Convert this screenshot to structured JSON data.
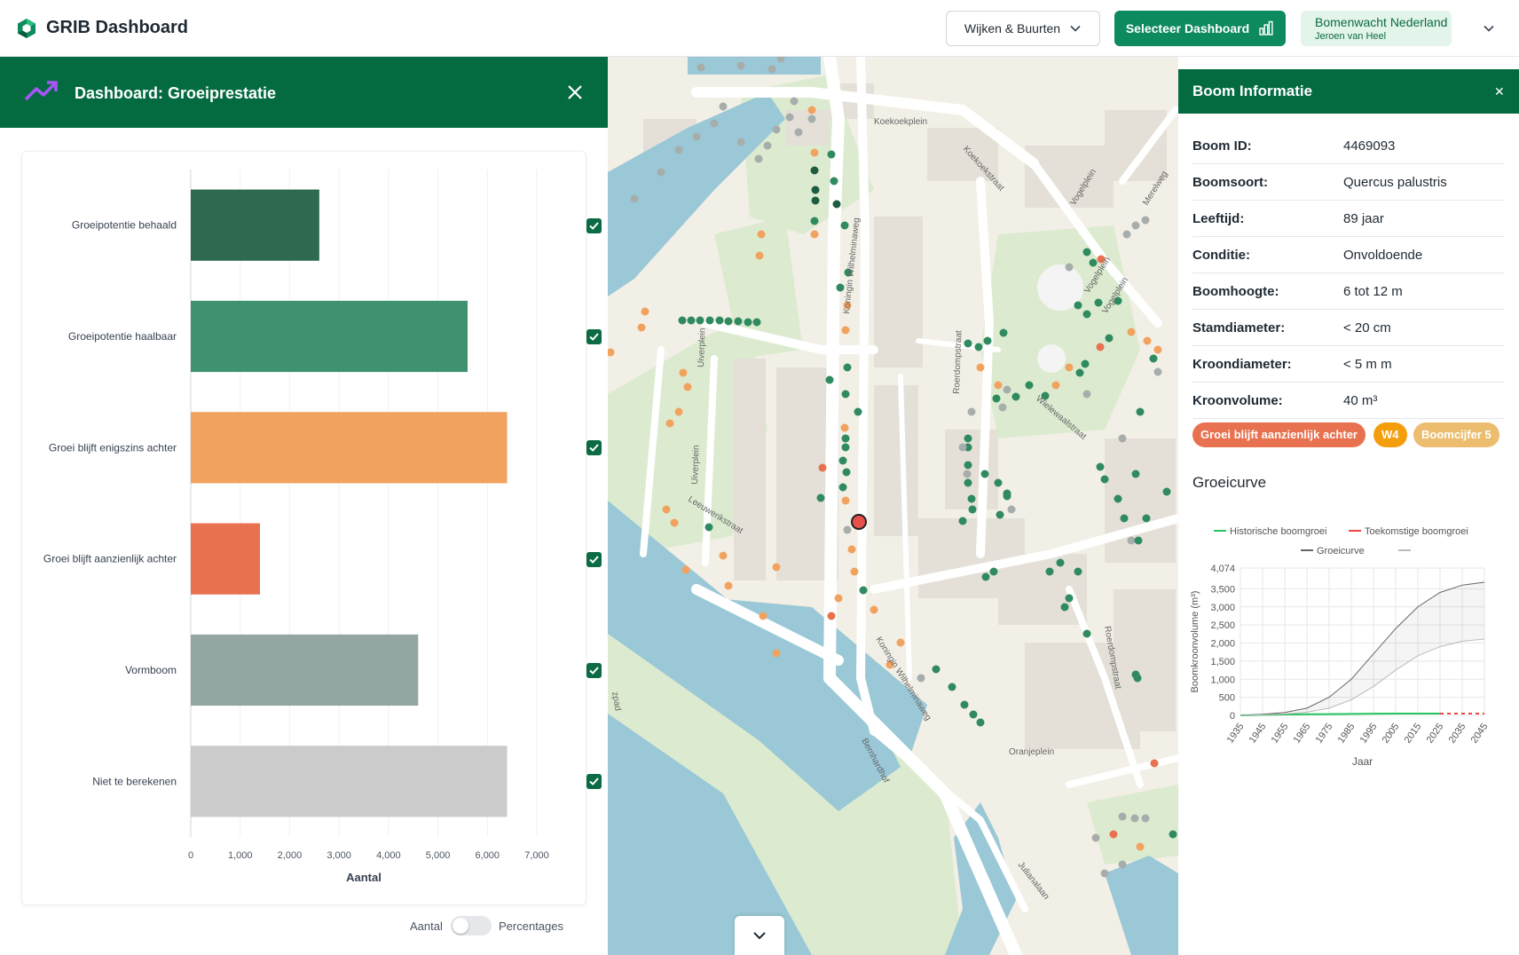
{
  "topbar": {
    "app_title": "GRIB Dashboard",
    "wijken_label": "Wijken & Buurten",
    "select_dashboard_label": "Selecteer Dashboard",
    "org_name": "Bomenwacht Nederland",
    "org_user": "Jeroen van Heel"
  },
  "dashboard": {
    "title": "Dashboard: Groeiprestatie",
    "toggle_left": "Aantal",
    "toggle_right": "Percentages",
    "toggle_state": "Aantal"
  },
  "chart_data": [
    {
      "type": "bar",
      "orientation": "horizontal",
      "categories": [
        "Groeipotentie behaald",
        "Groeipotentie haalbaar",
        "Groei blijft enigszins achter",
        "Groei blijft aanzienlijk achter",
        "Vormboom",
        "Niet te berekenen"
      ],
      "values": [
        2600,
        5600,
        6400,
        1400,
        4600,
        6400
      ],
      "colors": [
        "#2e6a4f",
        "#3f9270",
        "#f2a25f",
        "#e8714f",
        "#94a6a3",
        "#cbcbcb"
      ],
      "checked": [
        true,
        true,
        true,
        true,
        true,
        true
      ],
      "xlabel": "Aantal",
      "xlim": [
        0,
        7000
      ],
      "xticks": [
        "0",
        "1,000",
        "2,000",
        "3,000",
        "4,000",
        "5,000",
        "6,000",
        "7,000"
      ],
      "grid": true
    },
    {
      "type": "line",
      "title": "Groeicurve",
      "series": [
        {
          "name": "Historische boomgroei",
          "color": "#22c55e",
          "x": [
            1935,
            1945,
            1955,
            1965,
            1975,
            1985,
            1995,
            2005,
            2015,
            2025
          ],
          "y": [
            0,
            15,
            25,
            30,
            35,
            40,
            45,
            50,
            50,
            50
          ]
        },
        {
          "name": "Toekomstige boomgroei",
          "color": "#ef4444",
          "dashed": true,
          "x": [
            2025,
            2035,
            2045
          ],
          "y": [
            50,
            50,
            50
          ]
        },
        {
          "name": "Groeicurve",
          "color": "#666666",
          "x": [
            1935,
            1945,
            1955,
            1965,
            1975,
            1985,
            1995,
            2005,
            2015,
            2025,
            2035,
            2045
          ],
          "y": [
            0,
            30,
            80,
            200,
            500,
            1000,
            1700,
            2400,
            3000,
            3400,
            3600,
            3680
          ]
        },
        {
          "name": "",
          "color": "#bbbbbb",
          "x": [
            1935,
            1945,
            1955,
            1965,
            1975,
            1985,
            1995,
            2005,
            2015,
            2025,
            2035,
            2045
          ],
          "y": [
            0,
            15,
            40,
            90,
            200,
            430,
            800,
            1250,
            1650,
            1900,
            2050,
            2110
          ]
        }
      ],
      "xlabel": "Jaar",
      "ylabel": "Boomkroonvolume (m³)",
      "xlim": [
        1935,
        2045
      ],
      "ylim": [
        0,
        4074
      ],
      "yticks": [
        "4,074",
        "3,500",
        "3,000",
        "2,500",
        "2,000",
        "1,500",
        "1,000",
        "500",
        "0"
      ],
      "xticks": [
        "1935",
        "1945",
        "1955",
        "1965",
        "1975",
        "1985",
        "1995",
        "2005",
        "2015",
        "2025",
        "2035",
        "2045"
      ],
      "grid": true
    }
  ],
  "map": {
    "labels": [
      "Koekoekplein",
      "Koekoekstraat",
      "Vogelplein",
      "Vogelplein",
      "Vogelplein",
      "Koningin Wilhelminaweg",
      "Uiverplein",
      "Uiverplein",
      "Leeuwerikstraat",
      "Roerdompstraat",
      "Wielewaalstraat",
      "Koningin Wilhelminaweg",
      "Bernhardhof",
      "Oranjeplein",
      "Roerdompstraat",
      "Julianalaan",
      "Merelweg",
      "zpad"
    ],
    "colors": {
      "water": "#9ac8d6",
      "park": "#dcebd0",
      "road": "#ffffff",
      "building": "#e4e0d8"
    }
  },
  "boom": {
    "panel_title": "Boom Informatie",
    "rows": [
      {
        "label": "Boom ID:",
        "value": "4469093"
      },
      {
        "label": "Boomsoort:",
        "value": "Quercus palustris"
      },
      {
        "label": "Leeftijd:",
        "value": "89 jaar"
      },
      {
        "label": "Conditie:",
        "value": "Onvoldoende"
      },
      {
        "label": "Boomhoogte:",
        "value": "6 tot 12 m"
      },
      {
        "label": "Stamdiameter:",
        "value": "< 20 cm"
      },
      {
        "label": "Kroondiameter:",
        "value": "< 5 m m"
      },
      {
        "label": "Kroonvolume:",
        "value": "40 m³"
      }
    ],
    "badges": [
      {
        "label": "Groei blijft aanzienlijk achter",
        "color": "#e8714f"
      },
      {
        "label": "W4",
        "color": "#f59e0b"
      },
      {
        "label": "Boomcijfer 5",
        "color": "#ecbd6f"
      }
    ],
    "growth_title": "Groeicurve"
  }
}
